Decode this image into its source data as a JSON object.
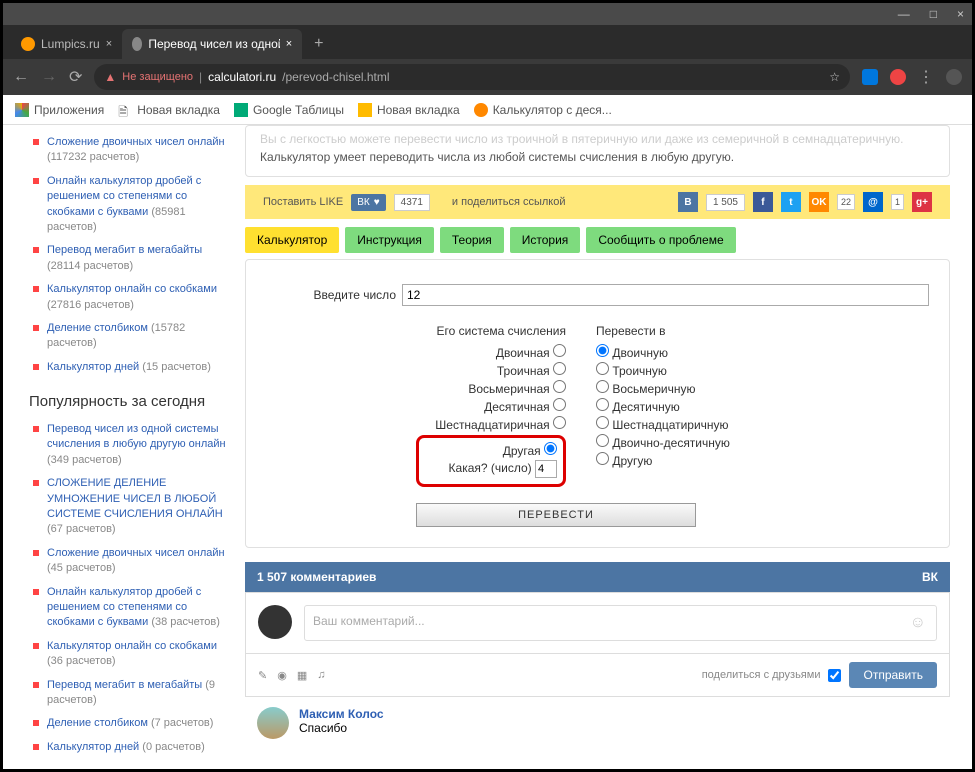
{
  "window": {
    "min": "—",
    "max": "□",
    "close": "×"
  },
  "tabs": {
    "t1": "Lumpics.ru",
    "t2": "Перевод чисел из одной систе...",
    "new": "+",
    "x": "×"
  },
  "addr": {
    "back": "←",
    "fwd": "→",
    "reload": "⟳",
    "insecure": "Не защищено",
    "domain": "calculatori.ru",
    "path": "/perevod-chisel.html",
    "star": "☆"
  },
  "bookmarks": {
    "apps": "Приложения",
    "b1": "Новая вкладка",
    "b2": "Google Таблицы",
    "b3": "Новая вкладка",
    "b4": "Калькулятор с деся..."
  },
  "sidebar": {
    "items": [
      {
        "t": "Сложение двоичных чисел онлайн",
        "c": "(117232 расчетов)"
      },
      {
        "t": "Онлайн калькулятор дробей с решением со степенями со скобками с буквами",
        "c": "(85981 расчетов)"
      },
      {
        "t": "Перевод мегабит в мегабайты",
        "c": "(28114 расчетов)"
      },
      {
        "t": "Калькулятор онлайн со скобками",
        "c": "(27816 расчетов)"
      },
      {
        "t": "Деление столбиком",
        "c": "(15782 расчетов)"
      },
      {
        "t": "Калькулятор дней",
        "c": "(15 расчетов)"
      }
    ],
    "head": "Популярность за сегодня",
    "today": [
      {
        "t": "Перевод чисел из одной системы счисления в любую другую онлайн",
        "c": "(349 расчетов)"
      },
      {
        "t": "СЛОЖЕНИЕ ДЕЛЕНИЕ УМНОЖЕНИЕ ЧИСЕЛ В ЛЮБОЙ СИСТЕМЕ СЧИСЛЕНИЯ ОНЛАЙН",
        "c": "(67 расчетов)"
      },
      {
        "t": "Сложение двоичных чисел онлайн",
        "c": "(45 расчетов)"
      },
      {
        "t": "Онлайн калькулятор дробей с решением со степенями со скобками с буквами",
        "c": "(38 расчетов)"
      },
      {
        "t": "Калькулятор онлайн со скобками",
        "c": "(36 расчетов)"
      },
      {
        "t": "Перевод мегабит в мегабайты",
        "c": "(9 расчетов)"
      },
      {
        "t": "Деление столбиком",
        "c": "(7 расчетов)"
      },
      {
        "t": "Калькулятор дней",
        "c": "(0 расчетов)"
      }
    ]
  },
  "intro": {
    "l1": "Вы с легкостью можете перевести число из троичной в пятеричную или даже из семеричной в семнадцатеричную.",
    "l2": "Калькулятор умеет переводить числа из любой системы счисления в любую другую."
  },
  "like": {
    "pre": "Поставить LIKE",
    "vk": "ВК",
    "heart": "♥",
    "cnt": "4371",
    "share": "и поделиться ссылкой",
    "b": "В",
    "bn": "1 505",
    "f": "f",
    "t": "t",
    "ok": "OK",
    "okn": "22",
    "m": "@",
    "mn": "1",
    "g": "g+"
  },
  "nav": {
    "t1": "Калькулятор",
    "t2": "Инструкция",
    "t3": "Теория",
    "t4": "История",
    "t5": "Сообщить о проблеме"
  },
  "calc": {
    "enter": "Введите число",
    "val": "12",
    "sysHead": "Его система счисления",
    "toHead": "Перевести в",
    "from": [
      "Двоичная",
      "Троичная",
      "Восьмеричная",
      "Десятичная",
      "Шестнадцатиричная"
    ],
    "other": "Другая",
    "which": "Какая? (число)",
    "whichVal": "4",
    "to": [
      "Двоичную",
      "Троичную",
      "Восьмеричную",
      "Десятичную",
      "Шестнадцатиричную",
      "Двоично-десятичную",
      "Другую"
    ],
    "btn": "ПЕРЕВЕСТИ"
  },
  "comments": {
    "head": "1 507 комментариев",
    "vk": "ВК",
    "ph": "Ваш комментарий...",
    "share": "поделиться с друзьями",
    "send": "Отправить",
    "name": "Максим Колос",
    "body": "Спасибо"
  }
}
